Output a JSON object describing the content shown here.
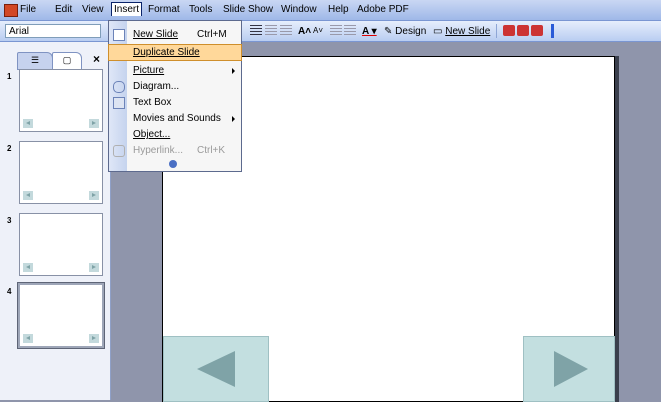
{
  "menubar": {
    "items": [
      "File",
      "Edit",
      "View",
      "Insert",
      "Format",
      "Tools",
      "Slide Show",
      "Window",
      "Help",
      "Adobe PDF"
    ],
    "active": "Insert"
  },
  "toolbar": {
    "font": "Arial",
    "design_label": "Design",
    "new_slide_label": "New Slide"
  },
  "pane": {
    "tab_close": "×",
    "thumbnails": [
      "1",
      "2",
      "3",
      "4"
    ]
  },
  "insert_menu": {
    "items": [
      {
        "label": "New Slide",
        "shortcut": "Ctrl+M"
      },
      {
        "label": "Duplicate Slide",
        "shortcut": ""
      },
      {
        "label": "Picture",
        "shortcut": "",
        "submenu": true
      },
      {
        "label": "Diagram...",
        "shortcut": ""
      },
      {
        "label": "Text Box",
        "shortcut": ""
      },
      {
        "label": "Movies and Sounds",
        "shortcut": "",
        "submenu": true
      },
      {
        "label": "Object...",
        "shortcut": ""
      },
      {
        "label": "Hyperlink...",
        "shortcut": "Ctrl+K",
        "disabled": true
      }
    ],
    "highlighted": "Duplicate Slide"
  },
  "colors": {
    "menubar": "#9fb8e8",
    "highlight": "#ffd89a",
    "nav_button": "#c3dfe0",
    "nav_arrow": "#7fa3a7"
  }
}
